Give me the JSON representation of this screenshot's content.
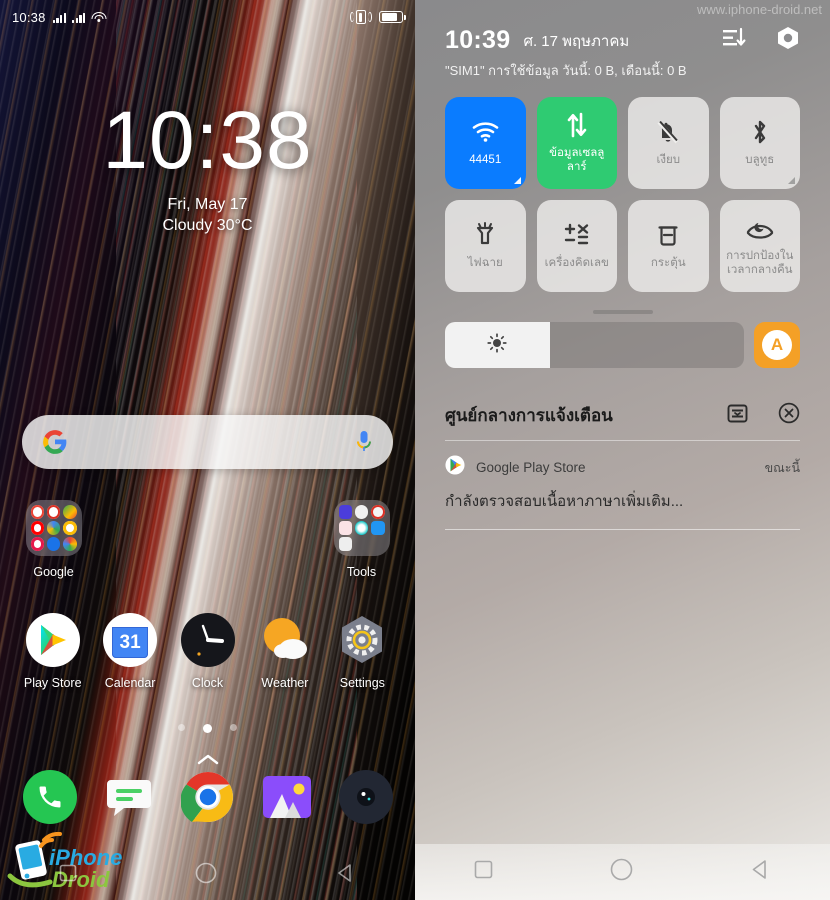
{
  "home": {
    "statusbar": {
      "time": "10:38",
      "icons": [
        "signal-bars",
        "signal-bars",
        "wifi-icon",
        "vibrate-icon",
        "battery-icon"
      ]
    },
    "clock_widget": {
      "time": "10:38",
      "date": "Fri, May 17",
      "weather": "Cloudy 30°C"
    },
    "search": {
      "logo": "google-g-icon",
      "mic": "microphone-icon",
      "placeholder": ""
    },
    "folders": [
      {
        "label": "Google",
        "icon": "google-folder-icon"
      },
      {
        "label": "Tools",
        "icon": "tools-folder-icon"
      }
    ],
    "apps": [
      {
        "label": "Play Store",
        "icon": "play-store-icon"
      },
      {
        "label": "Calendar",
        "icon": "calendar-icon",
        "badge": "31"
      },
      {
        "label": "Clock",
        "icon": "clock-icon"
      },
      {
        "label": "Weather",
        "icon": "weather-icon"
      },
      {
        "label": "Settings",
        "icon": "settings-gear-icon"
      }
    ],
    "pages": {
      "count": 3,
      "active": 2
    },
    "dock": [
      {
        "label": "Phone",
        "icon": "phone-icon"
      },
      {
        "label": "Messages",
        "icon": "messages-icon"
      },
      {
        "label": "Chrome",
        "icon": "chrome-icon"
      },
      {
        "label": "Gallery",
        "icon": "gallery-icon"
      },
      {
        "label": "Camera",
        "icon": "camera-icon"
      }
    ],
    "watermark": {
      "line1": "iPhone",
      "line2": "Droid"
    },
    "navbar": [
      "recents-square-icon",
      "home-circle-icon",
      "back-triangle-icon"
    ]
  },
  "control_center": {
    "watermark": "www.iphone-droid.net",
    "header": {
      "time": "10:39",
      "date": "ศ. 17 พฤษภาคม",
      "subtitle": "\"SIM1\" การใช้ข้อมูล วันนี้: 0 B, เดือนนี้: 0 B",
      "icons": [
        "edit-order-icon",
        "settings-gear-icon"
      ]
    },
    "tiles": [
      {
        "label": "44451",
        "icon": "wifi-icon",
        "state": "on-blue",
        "has_corner": true
      },
      {
        "label": "ข้อมูลเซลลูลาร์",
        "icon": "cellular-data-icon",
        "state": "on-green",
        "has_corner": false
      },
      {
        "label": "เงียบ",
        "icon": "bell-off-icon",
        "state": "off",
        "has_corner": false
      },
      {
        "label": "บลูทูธ",
        "icon": "bluetooth-icon",
        "state": "off",
        "has_corner": true
      },
      {
        "label": "ไฟฉาย",
        "icon": "flashlight-icon",
        "state": "off",
        "has_corner": false
      },
      {
        "label": "เครื่องคิดเลข",
        "icon": "calculator-icon",
        "state": "off",
        "has_corner": false
      },
      {
        "label": "กระตุ้น",
        "icon": "trash-clean-icon",
        "state": "off",
        "has_corner": false
      },
      {
        "label": "การปกป้องในเวลากลางคืน",
        "icon": "night-eye-icon",
        "state": "off",
        "has_corner": false
      }
    ],
    "brightness": {
      "icon": "brightness-sun-icon",
      "value_percent": 35,
      "auto_label": "A"
    },
    "notifications": {
      "title": "ศูนย์กลางการแจ้งเตือน",
      "icons": [
        "manage-notifications-icon",
        "clear-all-icon"
      ],
      "items": [
        {
          "app": "Google Play Store",
          "time": "ขณะนี้",
          "body": "กำลังตรวจสอบเนื้อหาภาษาเพิ่มเติม...",
          "icon": "play-store-icon"
        }
      ]
    },
    "navbar": [
      "recents-square-icon",
      "home-circle-icon",
      "back-triangle-icon"
    ]
  },
  "colors": {
    "accent_blue": "#0a7cff",
    "accent_green": "#2fcb72",
    "accent_orange": "#f4a026",
    "tile_off": "#efeeec"
  }
}
